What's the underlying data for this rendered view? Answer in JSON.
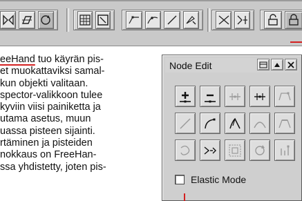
{
  "paragraph": {
    "lines": [
      "eeHand",
      " tuo käyrän pis-",
      "et muokattaviksi samal-",
      "kun objekti valitaan.",
      "spector-valikkoon tulee",
      "kyviin viisi painiketta ja",
      "utama asetus, muun",
      "uassa pisteen sijainti.",
      "rtäminen ja pisteiden",
      "nokkaus on FreeHan-",
      "ssa yhdistetty, joten pis-"
    ]
  },
  "palette": {
    "title": "Node Edit",
    "elastic_label": "Elastic Mode"
  },
  "colors": {
    "accent_red": "#d42020",
    "panel_gray": "#cfcfcf"
  }
}
